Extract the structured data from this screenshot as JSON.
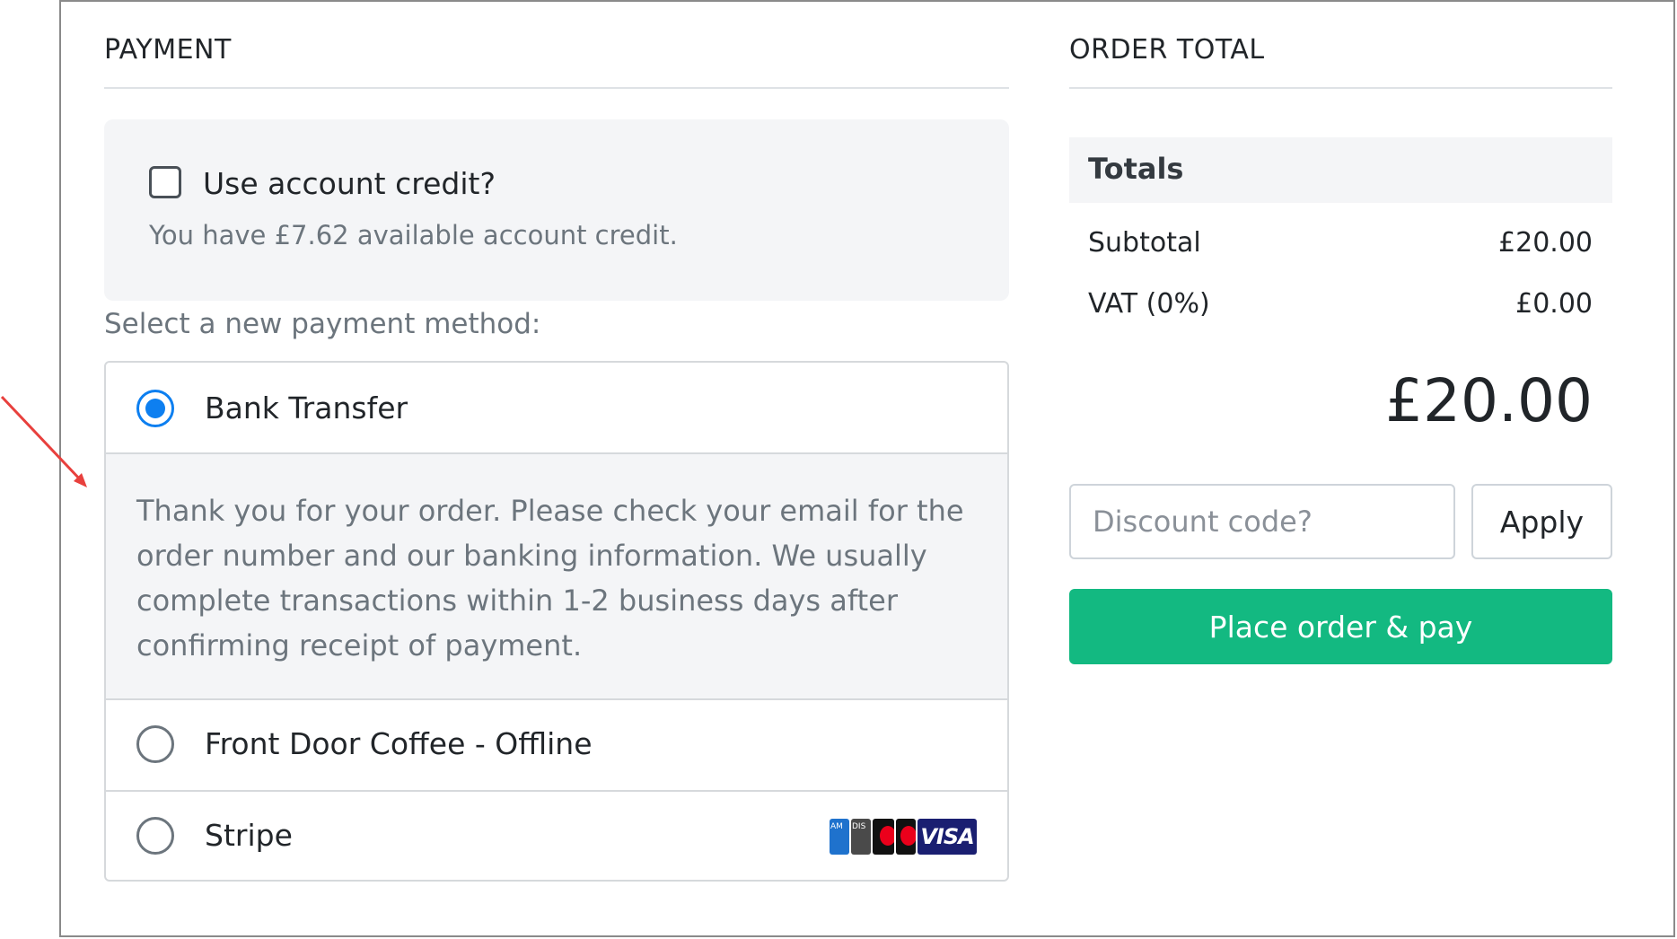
{
  "payment": {
    "title": "PAYMENT",
    "credit": {
      "label": "Use account credit?",
      "note": "You have £7.62 available account credit.",
      "checked": false
    },
    "select_label": "Select a new payment method:",
    "methods": [
      {
        "label": "Bank Transfer",
        "selected": true,
        "details": "Thank you for your order. Please check your email for the order number and our banking information. We usually complete transactions within 1-2 business days after confirming receipt of payment."
      },
      {
        "label": "Front Door Coffee - Offline",
        "selected": false
      },
      {
        "label": "Stripe",
        "selected": false,
        "card_logos": [
          "amex-icon",
          "discover-icon",
          "mastercard-icon",
          "maestro-icon",
          "visa-icon"
        ],
        "visa_text": "VISA"
      }
    ]
  },
  "order_total": {
    "title": "ORDER TOTAL",
    "totals_heading": "Totals",
    "rows": [
      {
        "label": "Subtotal",
        "value": "£20.00"
      },
      {
        "label": "VAT (0%)",
        "value": "£0.00"
      }
    ],
    "grand_total": "£20.00",
    "discount_placeholder": "Discount code?",
    "apply_label": "Apply",
    "place_order_label": "Place order & pay"
  },
  "colors": {
    "accent_blue": "#0d7ff0",
    "primary_green": "#13b981",
    "annotation_arrow": "#e8403d"
  }
}
